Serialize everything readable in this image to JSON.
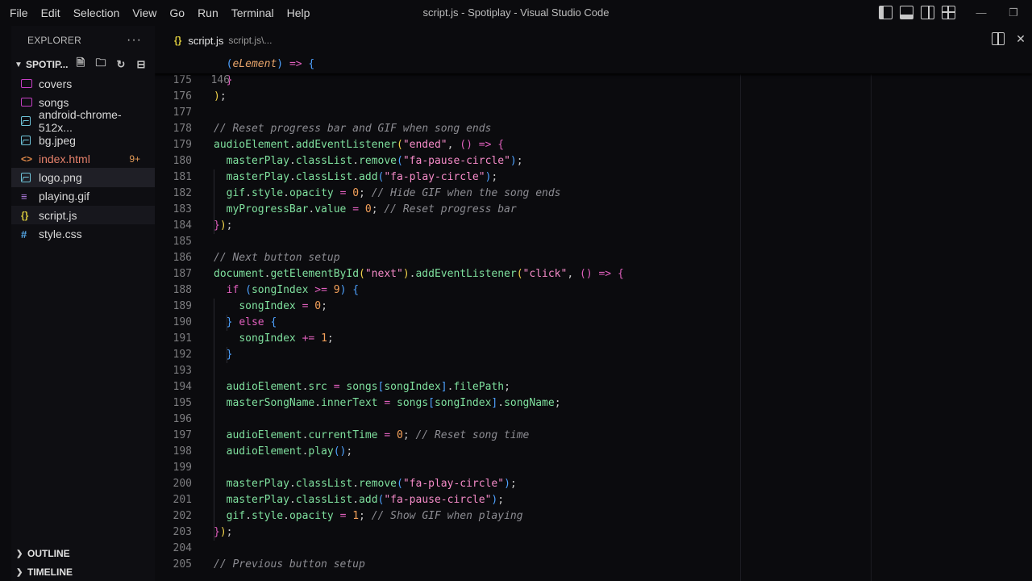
{
  "menu": [
    "File",
    "Edit",
    "Selection",
    "View",
    "Go",
    "Run",
    "Terminal",
    "Help"
  ],
  "window_title": "script.js - Spotiplay - Visual Studio Code",
  "explorer": {
    "title": "EXPLORER",
    "more": "···",
    "folder": "SPOTIP...",
    "items": [
      {
        "label": "covers",
        "icon": "folder-icon"
      },
      {
        "label": "songs",
        "icon": "folder-icon"
      },
      {
        "label": "android-chrome-512x...",
        "icon": "image-file-icon"
      },
      {
        "label": "bg.jpeg",
        "icon": "image-file-icon"
      },
      {
        "label": "index.html",
        "icon": "html-file-icon",
        "badge": "9+"
      },
      {
        "label": "logo.png",
        "icon": "image-file-icon"
      },
      {
        "label": "playing.gif",
        "icon": "gif-file-icon"
      },
      {
        "label": "script.js",
        "icon": "js-file-icon"
      },
      {
        "label": "style.css",
        "icon": "css-file-icon"
      }
    ],
    "outline": "OUTLINE",
    "timeline": "TIMELINE"
  },
  "tab": {
    "label": "script.js",
    "path": "script.js\\...",
    "icon_glyph": "{}"
  },
  "editor": {
    "sticky_line": {
      "number": "146"
    },
    "line_numbers": [
      "175",
      "176",
      "177",
      "178",
      "179",
      "180",
      "181",
      "182",
      "183",
      "184",
      "185",
      "186",
      "187",
      "188",
      "189",
      "190",
      "191",
      "192",
      "193",
      "194",
      "195",
      "196",
      "197",
      "198",
      "199",
      "200",
      "201",
      "202",
      "203",
      "204",
      "205"
    ]
  },
  "colors": {
    "accent": "#e05fbd",
    "modified": "#e5806a",
    "badge": "#e09956"
  }
}
